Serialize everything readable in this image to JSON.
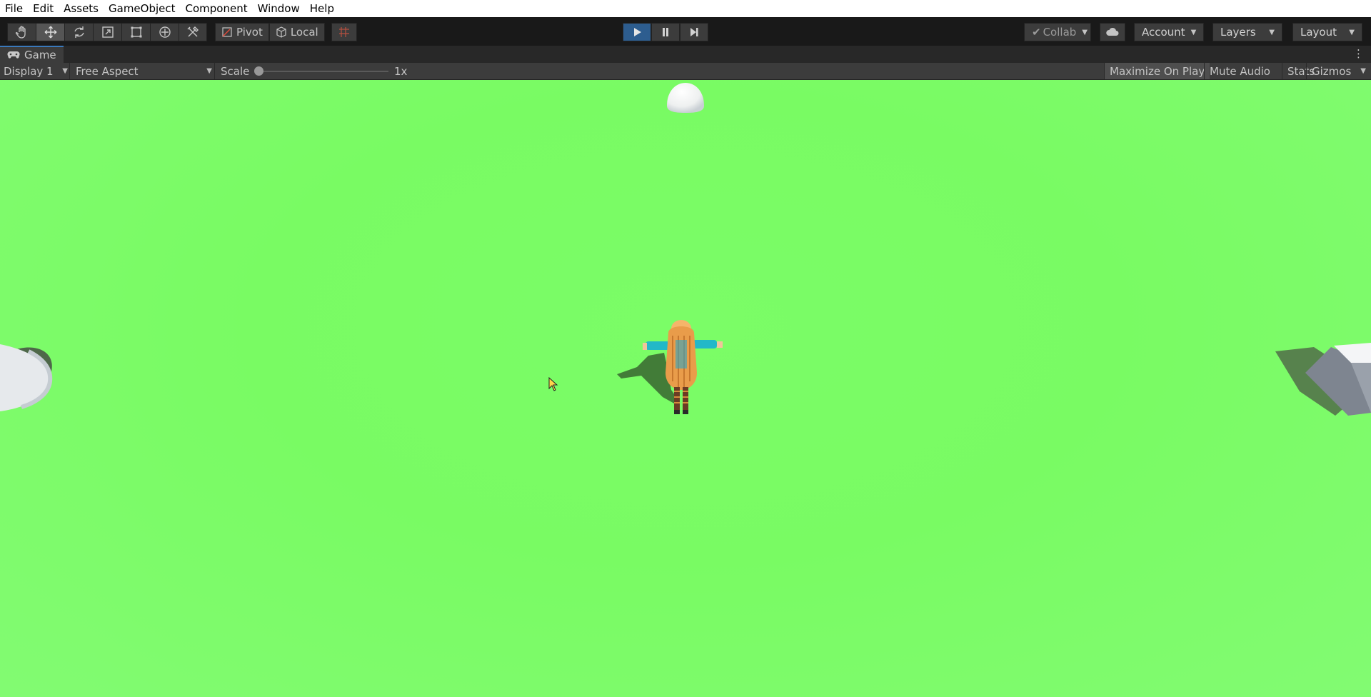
{
  "menu": {
    "items": [
      "File",
      "Edit",
      "Assets",
      "GameObject",
      "Component",
      "Window",
      "Help"
    ]
  },
  "toolbar": {
    "tools": [
      "hand-tool-icon",
      "move-tool-icon",
      "rotate-tool-icon",
      "scale-tool-icon",
      "rect-tool-icon",
      "transform-tool-icon",
      "custom-tool-icon"
    ],
    "active_tool": "move-tool-icon",
    "pivot_label": "Pivot",
    "local_label": "Local",
    "collab_label": "Collab",
    "account_label": "Account",
    "layers_label": "Layers",
    "layout_label": "Layout",
    "play_active": true
  },
  "game_tab": {
    "title": "Game"
  },
  "game_bar": {
    "display": "Display 1",
    "aspect": "Free Aspect",
    "scale_label": "Scale",
    "scale_value": "1x",
    "maximize_on_play": "Maximize On Play",
    "mute_audio": "Mute Audio",
    "stats": "Stats",
    "gizmos": "Gizmos"
  },
  "colors": {
    "ground": "#79fb63",
    "play_active": "#2d5d8f",
    "toolbar_bg": "#191919",
    "panel_bg": "#3c3c3c"
  }
}
